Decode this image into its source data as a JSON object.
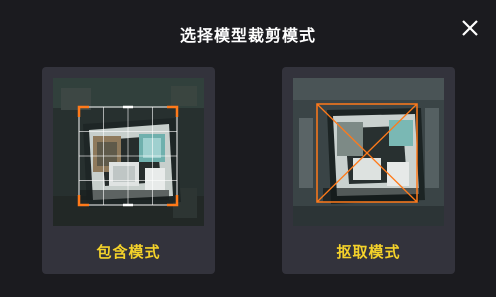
{
  "dialog": {
    "title": "选择模型裁剪模式",
    "close_icon": "close-icon"
  },
  "modes": [
    {
      "label": "包含模式",
      "icon": "crop-grid-icon"
    },
    {
      "label": "抠取模式",
      "icon": "crop-cross-icon"
    }
  ],
  "colors": {
    "background": "#1b1b1f",
    "card": "#33333c",
    "label": "#f4d22a",
    "crop_frame": "#ff7a1a",
    "title": "#ffffff"
  }
}
